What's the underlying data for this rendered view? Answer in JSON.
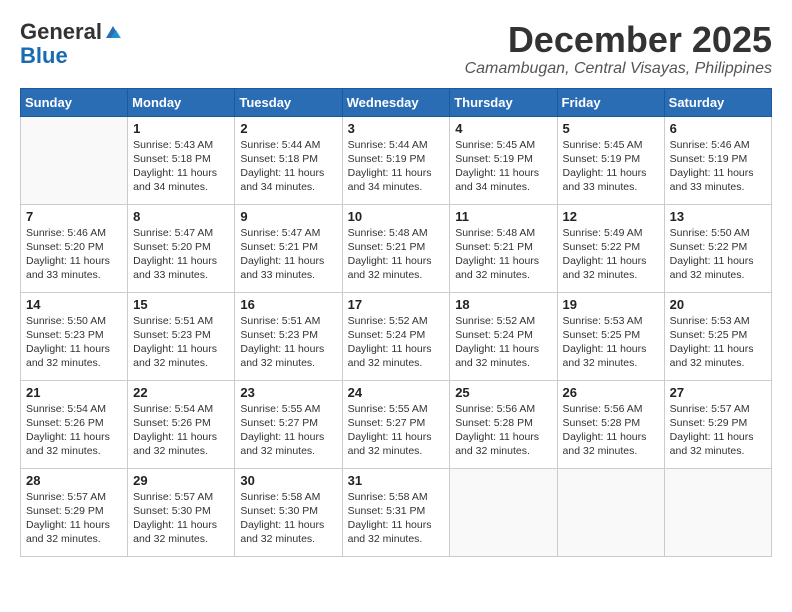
{
  "header": {
    "logo_general": "General",
    "logo_blue": "Blue",
    "month_year": "December 2025",
    "location": "Camambugan, Central Visayas, Philippines"
  },
  "weekdays": [
    "Sunday",
    "Monday",
    "Tuesday",
    "Wednesday",
    "Thursday",
    "Friday",
    "Saturday"
  ],
  "weeks": [
    [
      {
        "day": "",
        "info": ""
      },
      {
        "day": "1",
        "info": "Sunrise: 5:43 AM\nSunset: 5:18 PM\nDaylight: 11 hours\nand 34 minutes."
      },
      {
        "day": "2",
        "info": "Sunrise: 5:44 AM\nSunset: 5:18 PM\nDaylight: 11 hours\nand 34 minutes."
      },
      {
        "day": "3",
        "info": "Sunrise: 5:44 AM\nSunset: 5:19 PM\nDaylight: 11 hours\nand 34 minutes."
      },
      {
        "day": "4",
        "info": "Sunrise: 5:45 AM\nSunset: 5:19 PM\nDaylight: 11 hours\nand 34 minutes."
      },
      {
        "day": "5",
        "info": "Sunrise: 5:45 AM\nSunset: 5:19 PM\nDaylight: 11 hours\nand 33 minutes."
      },
      {
        "day": "6",
        "info": "Sunrise: 5:46 AM\nSunset: 5:19 PM\nDaylight: 11 hours\nand 33 minutes."
      }
    ],
    [
      {
        "day": "7",
        "info": "Sunrise: 5:46 AM\nSunset: 5:20 PM\nDaylight: 11 hours\nand 33 minutes."
      },
      {
        "day": "8",
        "info": "Sunrise: 5:47 AM\nSunset: 5:20 PM\nDaylight: 11 hours\nand 33 minutes."
      },
      {
        "day": "9",
        "info": "Sunrise: 5:47 AM\nSunset: 5:21 PM\nDaylight: 11 hours\nand 33 minutes."
      },
      {
        "day": "10",
        "info": "Sunrise: 5:48 AM\nSunset: 5:21 PM\nDaylight: 11 hours\nand 32 minutes."
      },
      {
        "day": "11",
        "info": "Sunrise: 5:48 AM\nSunset: 5:21 PM\nDaylight: 11 hours\nand 32 minutes."
      },
      {
        "day": "12",
        "info": "Sunrise: 5:49 AM\nSunset: 5:22 PM\nDaylight: 11 hours\nand 32 minutes."
      },
      {
        "day": "13",
        "info": "Sunrise: 5:50 AM\nSunset: 5:22 PM\nDaylight: 11 hours\nand 32 minutes."
      }
    ],
    [
      {
        "day": "14",
        "info": "Sunrise: 5:50 AM\nSunset: 5:23 PM\nDaylight: 11 hours\nand 32 minutes."
      },
      {
        "day": "15",
        "info": "Sunrise: 5:51 AM\nSunset: 5:23 PM\nDaylight: 11 hours\nand 32 minutes."
      },
      {
        "day": "16",
        "info": "Sunrise: 5:51 AM\nSunset: 5:23 PM\nDaylight: 11 hours\nand 32 minutes."
      },
      {
        "day": "17",
        "info": "Sunrise: 5:52 AM\nSunset: 5:24 PM\nDaylight: 11 hours\nand 32 minutes."
      },
      {
        "day": "18",
        "info": "Sunrise: 5:52 AM\nSunset: 5:24 PM\nDaylight: 11 hours\nand 32 minutes."
      },
      {
        "day": "19",
        "info": "Sunrise: 5:53 AM\nSunset: 5:25 PM\nDaylight: 11 hours\nand 32 minutes."
      },
      {
        "day": "20",
        "info": "Sunrise: 5:53 AM\nSunset: 5:25 PM\nDaylight: 11 hours\nand 32 minutes."
      }
    ],
    [
      {
        "day": "21",
        "info": "Sunrise: 5:54 AM\nSunset: 5:26 PM\nDaylight: 11 hours\nand 32 minutes."
      },
      {
        "day": "22",
        "info": "Sunrise: 5:54 AM\nSunset: 5:26 PM\nDaylight: 11 hours\nand 32 minutes."
      },
      {
        "day": "23",
        "info": "Sunrise: 5:55 AM\nSunset: 5:27 PM\nDaylight: 11 hours\nand 32 minutes."
      },
      {
        "day": "24",
        "info": "Sunrise: 5:55 AM\nSunset: 5:27 PM\nDaylight: 11 hours\nand 32 minutes."
      },
      {
        "day": "25",
        "info": "Sunrise: 5:56 AM\nSunset: 5:28 PM\nDaylight: 11 hours\nand 32 minutes."
      },
      {
        "day": "26",
        "info": "Sunrise: 5:56 AM\nSunset: 5:28 PM\nDaylight: 11 hours\nand 32 minutes."
      },
      {
        "day": "27",
        "info": "Sunrise: 5:57 AM\nSunset: 5:29 PM\nDaylight: 11 hours\nand 32 minutes."
      }
    ],
    [
      {
        "day": "28",
        "info": "Sunrise: 5:57 AM\nSunset: 5:29 PM\nDaylight: 11 hours\nand 32 minutes."
      },
      {
        "day": "29",
        "info": "Sunrise: 5:57 AM\nSunset: 5:30 PM\nDaylight: 11 hours\nand 32 minutes."
      },
      {
        "day": "30",
        "info": "Sunrise: 5:58 AM\nSunset: 5:30 PM\nDaylight: 11 hours\nand 32 minutes."
      },
      {
        "day": "31",
        "info": "Sunrise: 5:58 AM\nSunset: 5:31 PM\nDaylight: 11 hours\nand 32 minutes."
      },
      {
        "day": "",
        "info": ""
      },
      {
        "day": "",
        "info": ""
      },
      {
        "day": "",
        "info": ""
      }
    ]
  ]
}
